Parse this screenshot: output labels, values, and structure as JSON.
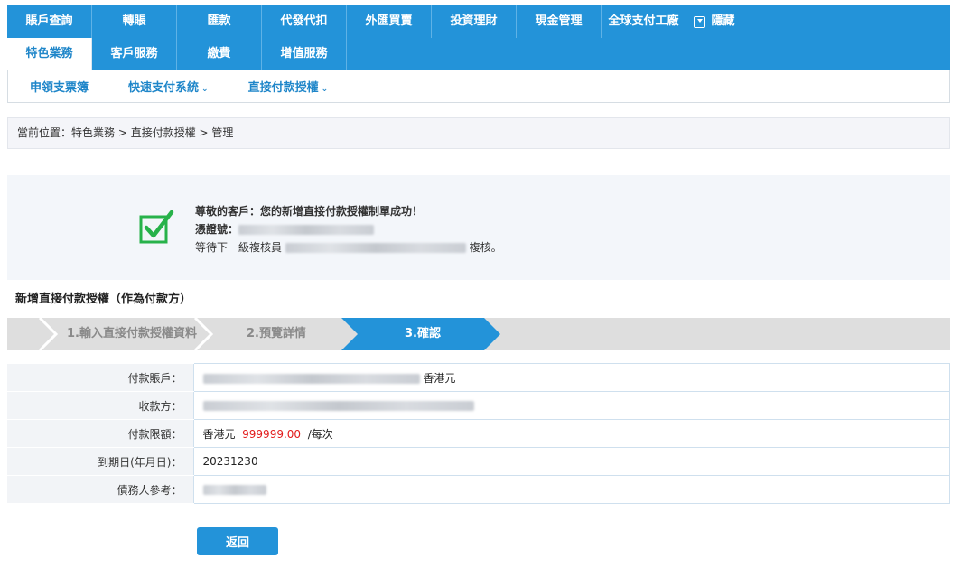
{
  "nav": {
    "row1": [
      {
        "id": "acct",
        "label": "賬戶查詢"
      },
      {
        "id": "transfer",
        "label": "轉賬"
      },
      {
        "id": "remit",
        "label": "匯款"
      },
      {
        "id": "payroll",
        "label": "代發代扣"
      },
      {
        "id": "fx",
        "label": "外匯買賣"
      },
      {
        "id": "invest",
        "label": "投資理財"
      },
      {
        "id": "cash",
        "label": "現金管理"
      },
      {
        "id": "global",
        "label": "全球支付工廠"
      }
    ],
    "hide_label": "隱藏",
    "row2": [
      {
        "id": "special",
        "label": "特色業務"
      },
      {
        "id": "service",
        "label": "客戶服務"
      },
      {
        "id": "bill",
        "label": "繳費"
      },
      {
        "id": "value",
        "label": "增值服務"
      }
    ]
  },
  "subnav": [
    {
      "id": "chequebook",
      "label": "申領支票簿",
      "caret": ""
    },
    {
      "id": "fps",
      "label": "快速支付系統",
      "caret": "⌄"
    },
    {
      "id": "ddi",
      "label": "直接付款授權",
      "caret": "⌄"
    }
  ],
  "breadcrumb": {
    "prefix": "當前位置：",
    "path": "特色業務 > 直接付款授權 > ",
    "current": "管理"
  },
  "success": {
    "title": "尊敬的客戶：您的新增直接付款授權制單成功！",
    "voucher_label": "憑證號：",
    "pending_prefix": "等待下一級複核員",
    "pending_suffix": "複核。"
  },
  "section_title": "新增直接付款授權（作為付款方）",
  "steps": [
    {
      "label": "1.輸入直接付款授權資料"
    },
    {
      "label": "2.預覽詳情"
    },
    {
      "label": "3.確認"
    }
  ],
  "form": {
    "rows": [
      {
        "label": "付款賬戶：",
        "suffix": "香港元"
      },
      {
        "label": "收款方："
      },
      {
        "label": "付款限額：",
        "currency": "香港元",
        "amount": "999999.00",
        "unit": "/每次"
      },
      {
        "label": "到期日(年月日)：",
        "value": "20231230"
      },
      {
        "label": "債務人參考："
      }
    ]
  },
  "buttons": {
    "back": "返回"
  },
  "colors": {
    "primary": "#2393d9",
    "success": "#27b24a",
    "amount": "#e21b1b"
  }
}
